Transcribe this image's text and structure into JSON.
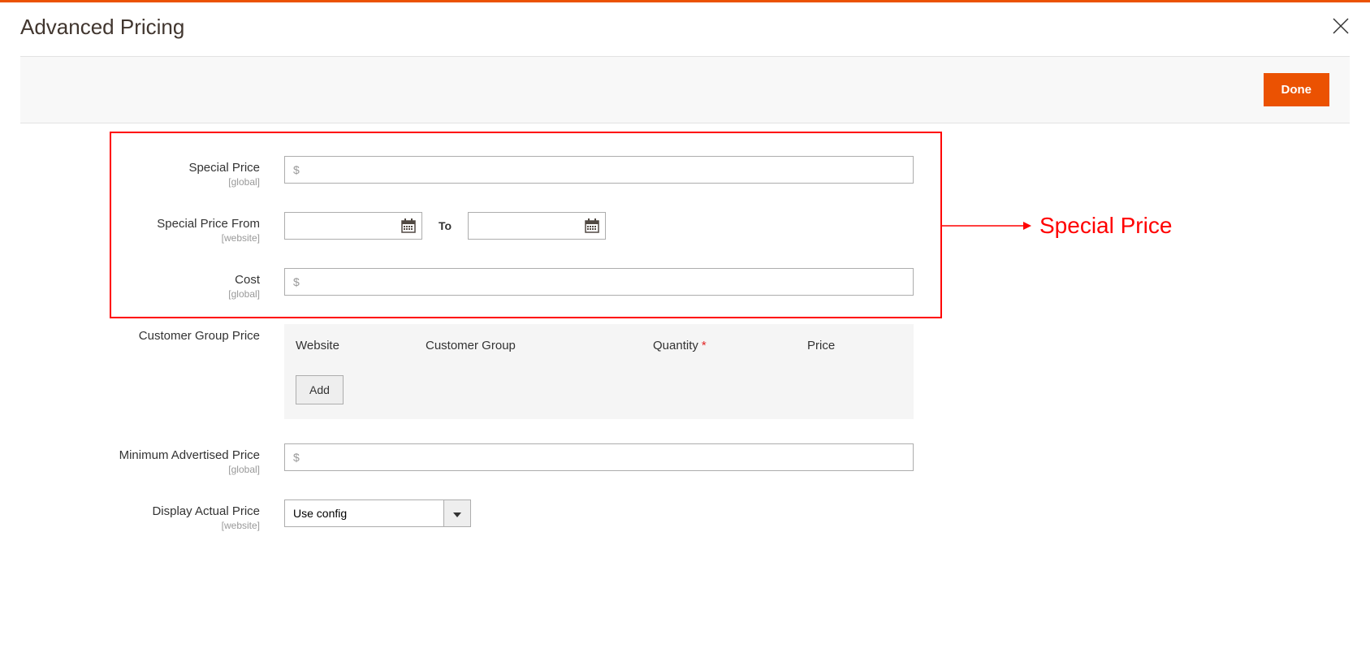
{
  "header": {
    "title": "Advanced Pricing"
  },
  "toolbar": {
    "done_label": "Done"
  },
  "fields": {
    "special_price": {
      "label": "Special Price",
      "scope": "[global]",
      "placeholder": "$"
    },
    "special_price_from": {
      "label": "Special Price From",
      "scope": "[website]",
      "to_label": "To"
    },
    "cost": {
      "label": "Cost",
      "scope": "[global]",
      "placeholder": "$"
    },
    "customer_group_price": {
      "label": "Customer Group Price"
    },
    "map": {
      "label": "Minimum Advertised Price",
      "scope": "[global]",
      "placeholder": "$"
    },
    "display_actual": {
      "label": "Display Actual Price",
      "scope": "[website]",
      "value": "Use config"
    }
  },
  "grid": {
    "headers": {
      "website": "Website",
      "group": "Customer Group",
      "qty": "Quantity",
      "price": "Price"
    },
    "add_label": "Add"
  },
  "annotation": {
    "text": "Special Price"
  }
}
